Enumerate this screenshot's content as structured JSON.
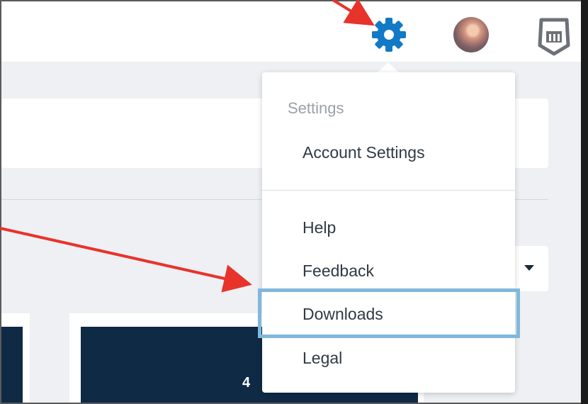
{
  "settings_menu": {
    "header": "Settings",
    "items": [
      {
        "label": "Account Settings"
      },
      {
        "label": "Help"
      },
      {
        "label": "Feedback"
      },
      {
        "label": "Downloads"
      },
      {
        "label": "Legal"
      }
    ]
  },
  "dashboard": {
    "tile_value": "4"
  },
  "icons": {
    "settings": "gear-icon",
    "user": "avatar",
    "app": "app-logo-icon",
    "dropdown": "caret-down-icon"
  },
  "colors": {
    "gear": "#1279c6",
    "highlight": "#80b8dc",
    "arrow": "#e8332a",
    "tile": "#0f2a45"
  }
}
